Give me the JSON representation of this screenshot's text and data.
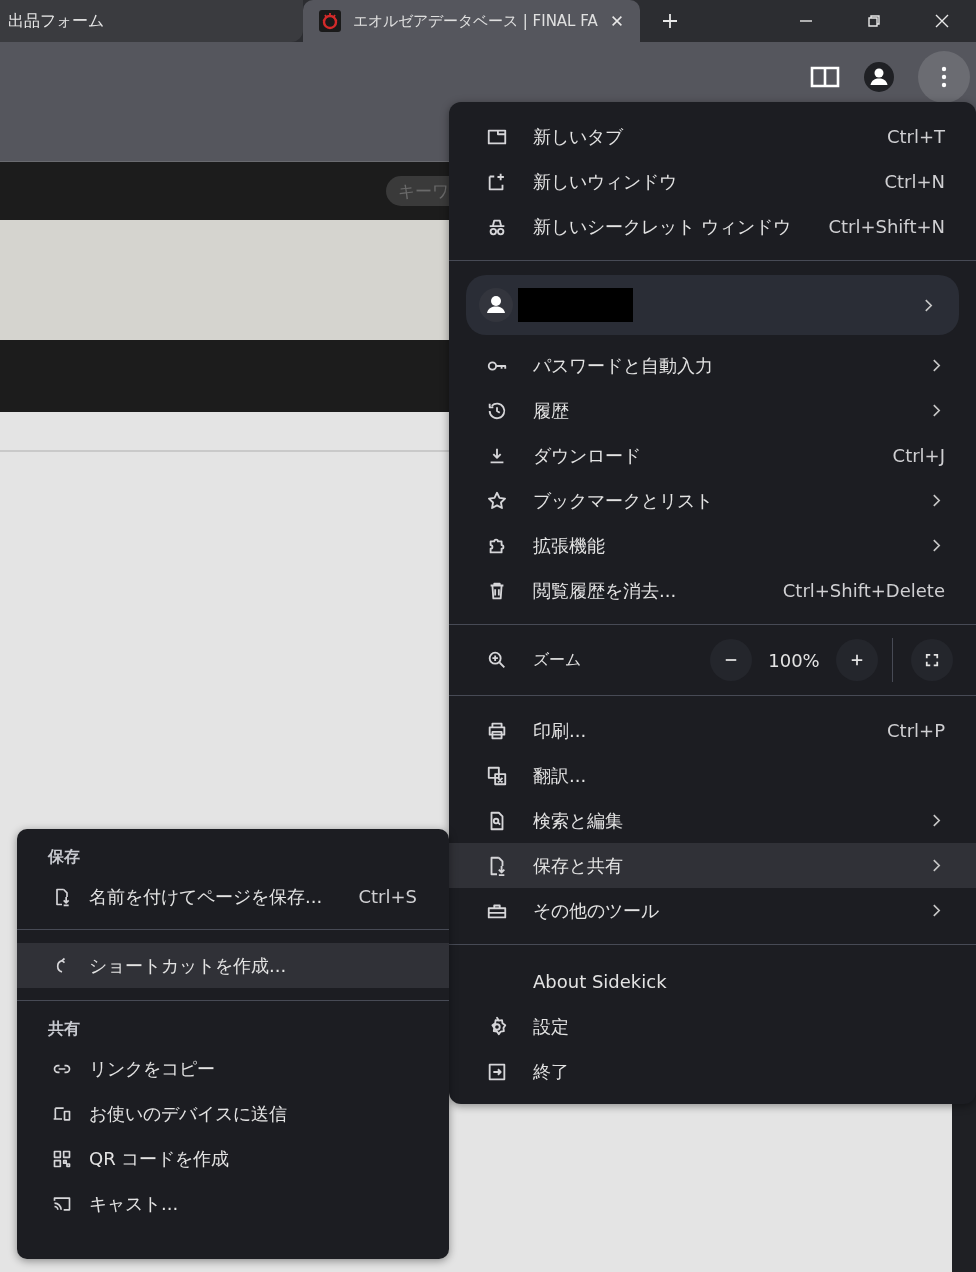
{
  "tabs": [
    {
      "title": "出品フォーム",
      "selected": false,
      "favicon": false
    },
    {
      "title": "エオルゼアデータベース | FINAL FA",
      "selected": true,
      "favicon": true
    }
  ],
  "page": {
    "search": {
      "placeholder": "キーワ"
    }
  },
  "menu": {
    "sections": [
      {
        "items": [
          {
            "kind": "item",
            "label": "新しいタブ",
            "shortcut": "Ctrl+T",
            "submenu": false,
            "selected": false
          },
          {
            "kind": "item",
            "label": "新しいウィンドウ",
            "shortcut": "Ctrl+N",
            "submenu": false,
            "selected": false
          },
          {
            "kind": "item",
            "label": "新しいシークレット ウィンドウ",
            "shortcut": "Ctrl+Shift+N",
            "submenu": false,
            "selected": false
          }
        ]
      },
      {
        "items": [
          {
            "kind": "profile",
            "redacted": true,
            "submenu": true
          },
          {
            "kind": "item",
            "label": "パスワードと自動入力",
            "submenu": true,
            "selected": false
          },
          {
            "kind": "item",
            "label": "履歴",
            "submenu": true,
            "selected": false
          },
          {
            "kind": "item",
            "label": "ダウンロード",
            "shortcut": "Ctrl+J",
            "submenu": false,
            "selected": false
          },
          {
            "kind": "item",
            "label": "ブックマークとリスト",
            "submenu": true,
            "selected": false
          },
          {
            "kind": "item",
            "label": "拡張機能",
            "submenu": true,
            "selected": false
          },
          {
            "kind": "item",
            "label": "閲覧履歴を消去...",
            "shortcut": "Ctrl+Shift+Delete",
            "submenu": false,
            "selected": false
          }
        ]
      },
      {
        "items": [
          {
            "kind": "zoom",
            "label": "ズーム",
            "value": "100%"
          }
        ]
      },
      {
        "items": [
          {
            "kind": "item",
            "label": "印刷...",
            "shortcut": "Ctrl+P",
            "submenu": false,
            "selected": false
          },
          {
            "kind": "item",
            "label": "翻訳...",
            "submenu": false,
            "selected": false
          },
          {
            "kind": "item",
            "label": "検索と編集",
            "submenu": true,
            "selected": false
          },
          {
            "kind": "item",
            "label": "保存と共有",
            "submenu": true,
            "selected": true
          },
          {
            "kind": "item",
            "label": "その他のツール",
            "submenu": true,
            "selected": false
          }
        ]
      },
      {
        "items": [
          {
            "kind": "item",
            "label": "About Sidekick",
            "submenu": false,
            "selected": false
          },
          {
            "kind": "item",
            "label": "設定",
            "submenu": false,
            "selected": false
          },
          {
            "kind": "item",
            "label": "終了",
            "submenu": false,
            "selected": false
          }
        ]
      }
    ]
  },
  "submenu": {
    "sections": [
      {
        "header": "保存",
        "items": [
          {
            "label": "名前を付けてページを保存...",
            "shortcut": "Ctrl+S",
            "selected": false
          }
        ]
      },
      {
        "items": [
          {
            "label": "ショートカットを作成...",
            "selected": true
          }
        ]
      },
      {
        "header": "共有",
        "items": [
          {
            "label": "リンクをコピー",
            "selected": false
          },
          {
            "label": "お使いのデバイスに送信",
            "selected": false
          },
          {
            "label": "QR コードを作成",
            "selected": false
          },
          {
            "label": "キャスト...",
            "selected": false
          }
        ]
      }
    ]
  }
}
